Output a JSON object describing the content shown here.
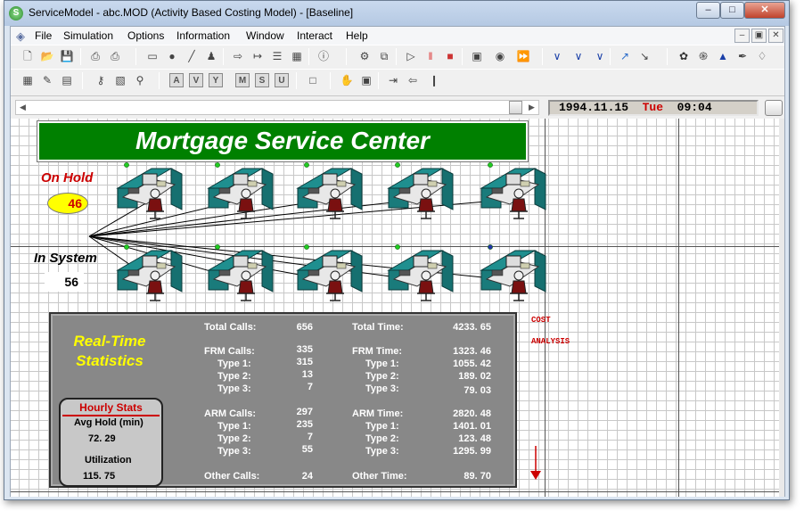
{
  "window": {
    "title": "ServiceModel - abc.MOD (Activity Based Costing Model) - [Baseline]",
    "app_icon_letter": "S",
    "controls": {
      "minimize": "–",
      "maximize": "□",
      "close": "✕"
    }
  },
  "menu": {
    "items": [
      "File",
      "Simulation",
      "Options",
      "Information",
      "Window",
      "Interact",
      "Help"
    ],
    "mdi_controls": [
      "–",
      "▣",
      "✕"
    ]
  },
  "toolbar": {
    "row1_icons": [
      "new-file-icon",
      "open-file-icon",
      "save-icon",
      "print-icon",
      "print-setup-icon",
      "rectangle-icon",
      "circle-icon",
      "route-icon",
      "figure-icon",
      "step-icon",
      "send-icon",
      "queue-icon",
      "schedule-icon",
      "info-icon",
      "settings-icon",
      "copy-windows-icon",
      "run-icon",
      "pause-icon",
      "stop-icon",
      "animation-icon",
      "sphere-icon",
      "step-forward-icon",
      "resource-a-icon",
      "resource-b-icon",
      "resource-c-icon",
      "chart-icon",
      "chart-edit-icon",
      "palette-icon",
      "spiral-icon",
      "triangle-icon",
      "paint-icon",
      "shapes-icon"
    ],
    "row2_icons": [
      "table-icon",
      "edit-form-icon",
      "grid-icon",
      "key-icon",
      "map-icon",
      "zoom-icon",
      "hand-icon",
      "record-icon",
      "exit-icon",
      "export-icon",
      "import-icon"
    ],
    "letter_buttons": [
      "A",
      "V",
      "Y",
      "M",
      "S",
      "U"
    ]
  },
  "clock": {
    "date": "1994.11.15",
    "day": "Tue",
    "time": "09:04"
  },
  "model": {
    "title": "Mortgage Service Center",
    "on_hold_label": "On Hold",
    "on_hold_value": "46",
    "in_system_label": "In System",
    "in_system_value": "56",
    "stats_title_line1": "Real-Time",
    "stats_title_line2": "Statistics",
    "stats": {
      "total_calls_label": "Total Calls:",
      "total_calls": "656",
      "frm_calls_label": "FRM Calls:",
      "frm_calls": "335",
      "frm_type1_label": "Type 1:",
      "frm_type1": "315",
      "frm_type2_label": "Type 2:",
      "frm_type2": "13",
      "frm_type3_label": "Type 3:",
      "frm_type3": "7",
      "arm_calls_label": "ARM Calls:",
      "arm_calls": "297",
      "arm_type1_label": "Type 1:",
      "arm_type1": "235",
      "arm_type2_label": "Type 2:",
      "arm_type2": "7",
      "arm_type3_label": "Type 3:",
      "arm_type3": "55",
      "other_calls_label": "Other Calls:",
      "other_calls": "24",
      "total_time_label": "Total Time:",
      "total_time": "4233. 65",
      "frm_time_label": "FRM Time:",
      "frm_time": "1323. 46",
      "frm_t1_label": "Type 1:",
      "frm_t1": "1055. 42",
      "frm_t2_label": "Type 2:",
      "frm_t2": "189. 02",
      "frm_t3_label": "Type 3:",
      "frm_t3": "79. 03",
      "arm_time_label": "ARM Time:",
      "arm_time": "2820. 48",
      "arm_t1_label": "Type 1:",
      "arm_t1": "1401. 01",
      "arm_t2_label": "Type 2:",
      "arm_t2": "123. 48",
      "arm_t3_label": "Type 3:",
      "arm_t3": "1295. 99",
      "other_time_label": "Other Time:",
      "other_time": "89. 70"
    },
    "hourly": {
      "title": "Hourly Stats",
      "avg_hold_label": "Avg Hold (min)",
      "avg_hold": "72. 29",
      "utilization_label": "Utilization",
      "utilization": "115. 75"
    },
    "cost_analysis": "COST\n\nANALYSIS",
    "colors": {
      "banner": "#008000",
      "accent_red": "#cc0000",
      "highlight_yellow": "#ffff00",
      "panel_gray": "#888888",
      "cubicle_teal": "#1f8f8f"
    }
  }
}
